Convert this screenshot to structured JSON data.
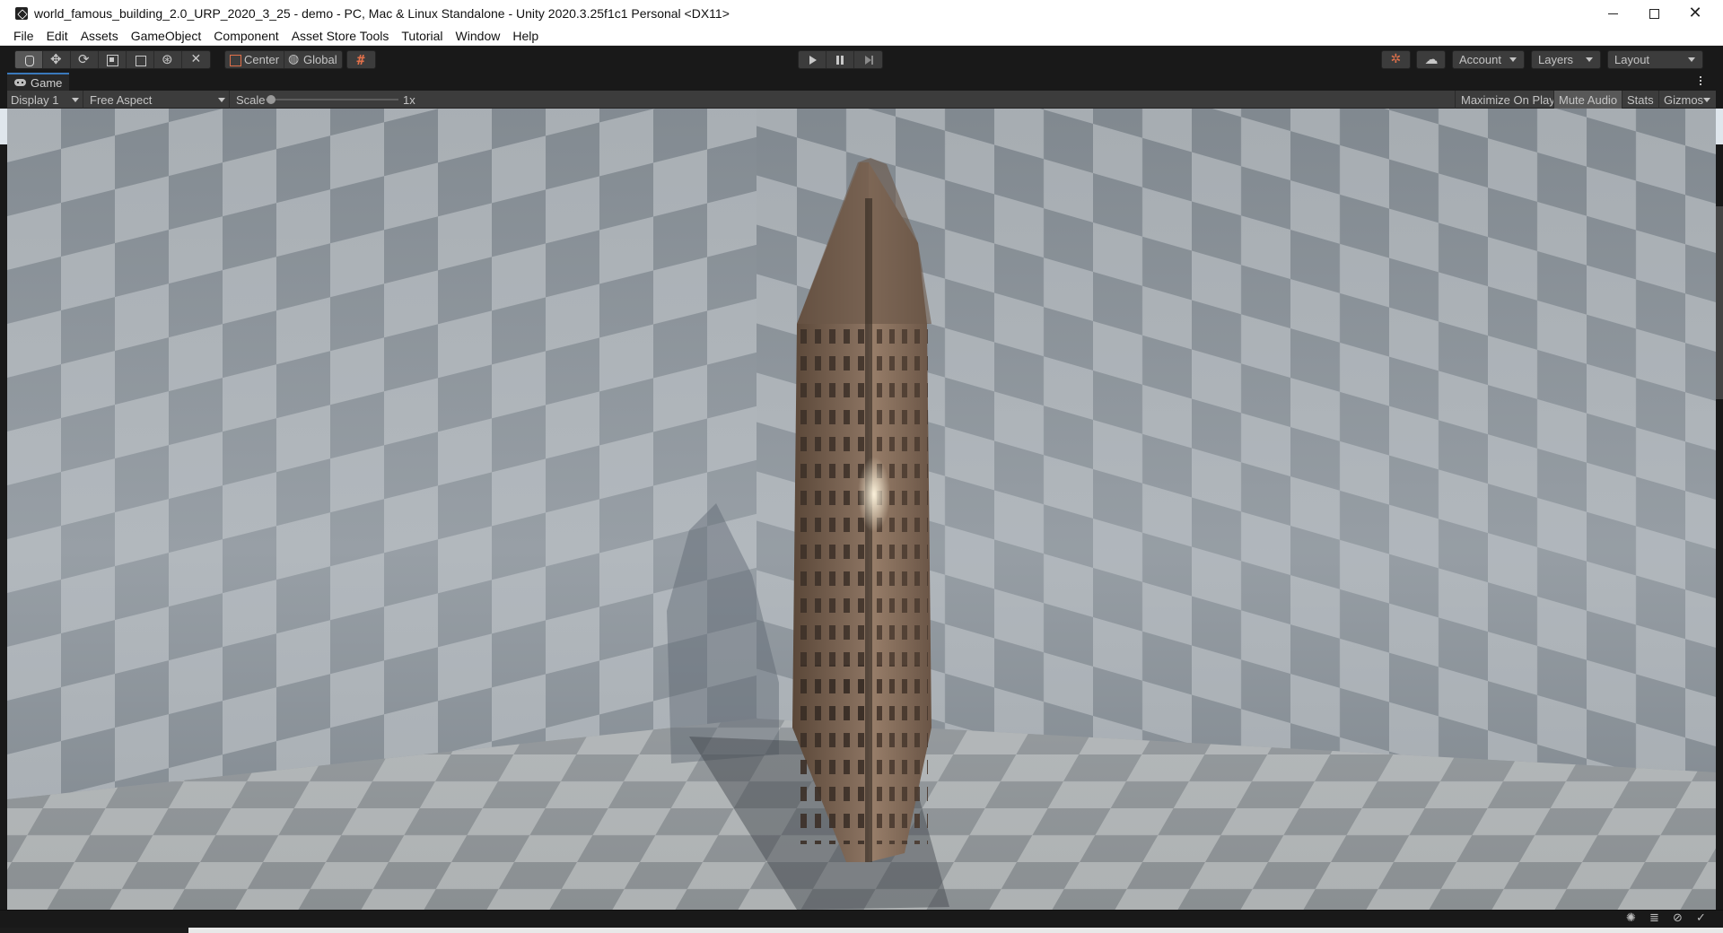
{
  "window": {
    "title": "world_famous_building_2.0_URP_2020_3_25 - demo - PC, Mac & Linux Standalone - Unity 2020.3.25f1c1 Personal <DX11>"
  },
  "menu": {
    "items": [
      "File",
      "Edit",
      "Assets",
      "GameObject",
      "Component",
      "Asset Store Tools",
      "Tutorial",
      "Window",
      "Help"
    ]
  },
  "toolbar": {
    "tools": [
      {
        "name": "hand-tool",
        "icon": "hand-icon"
      },
      {
        "name": "move-tool",
        "icon": "move-icon"
      },
      {
        "name": "rotate-tool",
        "icon": "rotate-icon"
      },
      {
        "name": "scale-tool",
        "icon": "scale-icon"
      },
      {
        "name": "rect-tool",
        "icon": "rect-icon"
      },
      {
        "name": "transform-tool",
        "icon": "transform-icon"
      },
      {
        "name": "custom-tool",
        "icon": "tools-icon"
      }
    ],
    "pivot_label": "Center",
    "space_label": "Global",
    "account_label": "Account",
    "layers_label": "Layers",
    "layout_label": "Layout"
  },
  "game_panel": {
    "tab_label": "Game",
    "display_label": "Display 1",
    "aspect_label": "Free Aspect",
    "scale_label": "Scale",
    "scale_value": "1x",
    "maximize_label": "Maximize On Play",
    "mute_label": "Mute Audio",
    "stats_label": "Stats",
    "gizmos_label": "Gizmos"
  },
  "colors": {
    "accent_orange": "#e0704a",
    "tab_highlight": "#3a79bb",
    "editor_bg": "#191919",
    "control_bg": "#3c3c3c"
  }
}
